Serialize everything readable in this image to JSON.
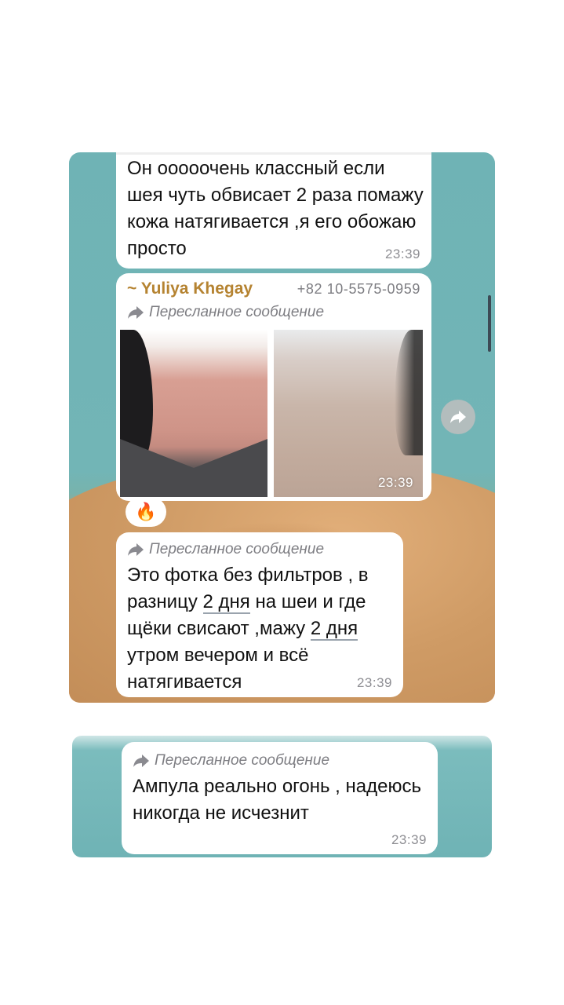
{
  "messages": {
    "first": {
      "text": "Он ооооочень классный если шея чуть обвисает 2 раза помажу кожа натягивается ,я его обожаю просто",
      "time": "23:39"
    },
    "photo": {
      "sender_name": "~ Yuliya Khegay",
      "sender_phone": "+82 10-5575-0959",
      "forward_label": "Пересланное сообщение",
      "time": "23:39",
      "reaction": "🔥"
    },
    "third": {
      "forward_label": "Пересланное сообщение",
      "text_part1": "Это фотка без фильтров , в разницу ",
      "link1": "2 дня",
      "text_part2": "  на шеи и где щёки свисают ,мажу ",
      "link2": "2 дня",
      "text_part3": " утром вечером и всё натягивается",
      "time": "23:39"
    },
    "fourth": {
      "forward_label": "Пересланное сообщение",
      "text": "Ампула реально огонь , надеюсь никогда не исчезнит",
      "time": "23:39"
    }
  },
  "icons": {
    "forward": "forward-arrow-icon",
    "share": "share-arrow-icon"
  },
  "colors": {
    "sender_name": "#b58331",
    "chat_bg_teal": "#6fb3b5",
    "sand": "#d6a36e"
  }
}
